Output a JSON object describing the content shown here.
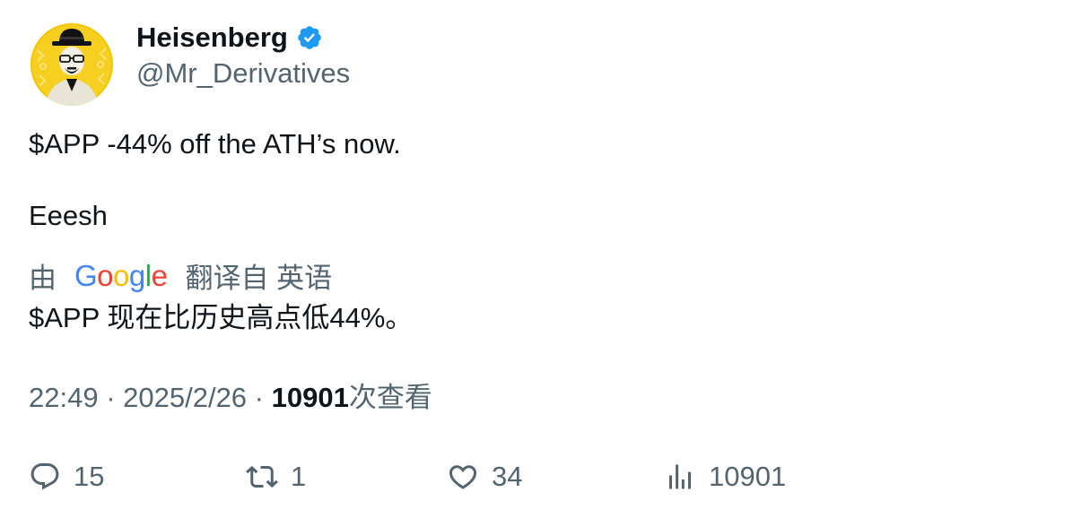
{
  "author": {
    "display_name": "Heisenberg",
    "handle": "@Mr_Derivatives",
    "verified_color": "#1d9bf0",
    "avatar_bg": "#f5c400"
  },
  "tweet": {
    "line1": "$APP -44% off the ATH’s now.",
    "line2": "Eeesh"
  },
  "translation": {
    "by": "由",
    "google_letters": [
      "G",
      "o",
      "o",
      "g",
      "l",
      "e"
    ],
    "link": "翻译自 英语",
    "text": "$APP 现在比历史高点低44%。"
  },
  "meta": {
    "time": "22:49",
    "sep1": " · ",
    "date": "2025/2/26",
    "sep2": " · ",
    "views_count": "10901",
    "views_label": "次查看"
  },
  "actions": {
    "replies": "15",
    "reposts": "1",
    "likes": "34",
    "views": "10901"
  },
  "colors": {
    "text": "#0f1419",
    "secondary": "#536471",
    "google_blue": "#4285F4",
    "google_red": "#EA4335",
    "google_yellow": "#FBBC05",
    "google_green": "#34A853"
  }
}
